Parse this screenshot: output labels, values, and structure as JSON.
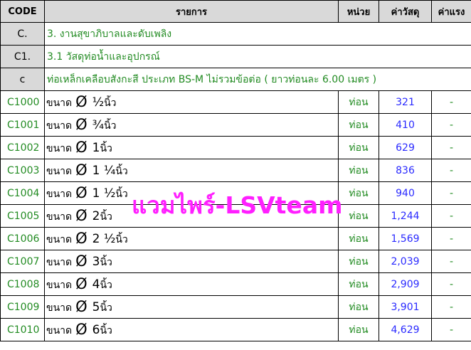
{
  "headers": {
    "code": "CODE",
    "item": "รายการ",
    "unit": "หน่วย",
    "material_cost": "ค่าวัสดุ",
    "labor_cost": "ค่าแรง"
  },
  "sections": [
    {
      "code": "C.",
      "title": "3. งานสุขาภิบาลและดับเพลิง"
    },
    {
      "code": "C1.",
      "title": "3.1 วัสดุท่อน้ำและอุปกรณ์"
    },
    {
      "code": "c",
      "title": "ท่อเหล็กเคลือบสังกะสี ประเภท BS-M ไม่รวมข้อต่อ  ( ยาวท่อนละ 6.00 เมตร )"
    }
  ],
  "items": [
    {
      "code": "C1000",
      "prefix": "ขนาด",
      "symbol": "Ø",
      "size": "½",
      "suffix": "นิ้ว",
      "unit": "ท่อน",
      "material": "321",
      "labor": "-"
    },
    {
      "code": "C1001",
      "prefix": "ขนาด",
      "symbol": "Ø",
      "size": "¾",
      "suffix": "นิ้ว",
      "unit": "ท่อน",
      "material": "410",
      "labor": "-"
    },
    {
      "code": "C1002",
      "prefix": "ขนาด",
      "symbol": "Ø",
      "size": "1",
      "suffix": "นิ้ว",
      "unit": "ท่อน",
      "material": "629",
      "labor": "-"
    },
    {
      "code": "C1003",
      "prefix": "ขนาด",
      "symbol": "Ø",
      "size": "1 ¼",
      "suffix": "นิ้ว",
      "unit": "ท่อน",
      "material": "836",
      "labor": "-"
    },
    {
      "code": "C1004",
      "prefix": "ขนาด",
      "symbol": "Ø",
      "size": "1 ½",
      "suffix": "นิ้ว",
      "unit": "ท่อน",
      "material": "940",
      "labor": "-"
    },
    {
      "code": "C1005",
      "prefix": "ขนาด",
      "symbol": "Ø",
      "size": "2",
      "suffix": "นิ้ว",
      "unit": "ท่อน",
      "material": "1,244",
      "labor": "-"
    },
    {
      "code": "C1006",
      "prefix": "ขนาด",
      "symbol": "Ø",
      "size": "2 ½",
      "suffix": "นิ้ว",
      "unit": "ท่อน",
      "material": "1,569",
      "labor": "-"
    },
    {
      "code": "C1007",
      "prefix": "ขนาด",
      "symbol": "Ø",
      "size": "3",
      "suffix": "นิ้ว",
      "unit": "ท่อน",
      "material": "2,039",
      "labor": "-"
    },
    {
      "code": "C1008",
      "prefix": "ขนาด",
      "symbol": "Ø",
      "size": "4",
      "suffix": "นิ้ว",
      "unit": "ท่อน",
      "material": "2,909",
      "labor": "-"
    },
    {
      "code": "C1009",
      "prefix": "ขนาด",
      "symbol": "Ø",
      "size": "5",
      "suffix": "นิ้ว",
      "unit": "ท่อน",
      "material": "3,901",
      "labor": "-"
    },
    {
      "code": "C1010",
      "prefix": "ขนาด",
      "symbol": "Ø",
      "size": "6",
      "suffix": "นิ้ว",
      "unit": "ท่อน",
      "material": "4,629",
      "labor": "-"
    }
  ],
  "watermark": "แวมไพร์-LSVteam",
  "colors": {
    "header_bg": "#d9d9d9",
    "code_green": "#228b22",
    "price_blue": "#2a2aff",
    "watermark_magenta": "#ff1fff"
  }
}
